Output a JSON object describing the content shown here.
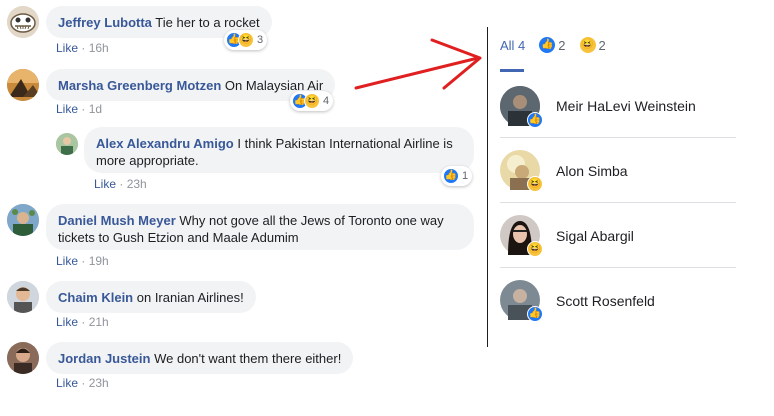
{
  "comments": [
    {
      "author": "Jeffrey Lubotta",
      "text": "Tie her to a rocket",
      "like": "Like",
      "time": "16h",
      "reactions": "3"
    },
    {
      "author": "Marsha Greenberg Motzen",
      "text": "On Malaysian Air",
      "like": "Like",
      "time": "1d",
      "reactions": "4"
    },
    {
      "author": "Alex Alexandru Amigo",
      "text": "I think Pakistan International Airline is",
      "text2": "more appropriate.",
      "like": "Like",
      "time": "23h",
      "reactions": "1"
    },
    {
      "author": "Daniel Mush Meyer",
      "text": "Why not gove all the Jews of Toronto one way",
      "text2": "tickets to Gush Etzion and Maale Adumim",
      "like": "Like",
      "time": "19h"
    },
    {
      "author": "Chaim Klein",
      "text": "on Iranian Airlines!",
      "like": "Like",
      "time": "21h"
    },
    {
      "author": "Jordan Justein",
      "text": "We don't want them there either!",
      "like": "Like",
      "time": "23h"
    }
  ],
  "dot_sep": "·",
  "reactions_panel": {
    "tab_all": "All 4",
    "tab_like_count": "2",
    "tab_haha_count": "2",
    "reactors": [
      {
        "name": "Meir HaLevi Weinstein",
        "reaction": "like-icon"
      },
      {
        "name": "Alon Simba",
        "reaction": "haha-icon"
      },
      {
        "name": "Sigal Abargil",
        "reaction": "haha-icon"
      },
      {
        "name": "Scott Rosenfeld",
        "reaction": "like-icon"
      }
    ]
  },
  "colors": {
    "link_blue": "#385898",
    "accent": "#4267b2",
    "like_blue": "#2078f4",
    "haha_yellow": "#f7c33c",
    "annotation_arrow": "#e02020"
  }
}
